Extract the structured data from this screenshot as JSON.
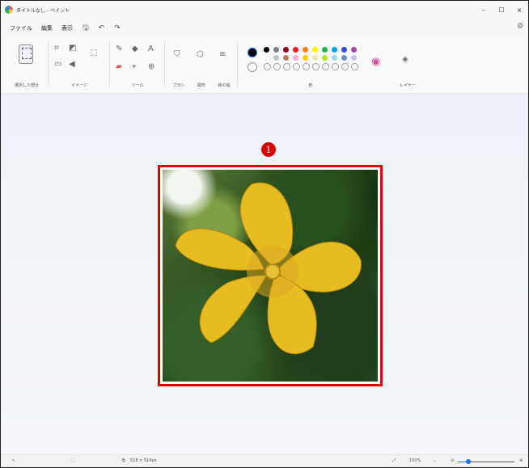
{
  "window": {
    "title": "タイトルなし - ペイント",
    "controls": {
      "minimize": "–",
      "maximize": "☐",
      "close": "×"
    }
  },
  "menu": {
    "file": "ファイル",
    "edit": "編集",
    "view": "表示",
    "save_icon": "save-icon",
    "undo_icon": "undo-icon",
    "redo_icon": "redo-icon",
    "settings_icon": "settings-icon"
  },
  "ribbon": {
    "groups": {
      "selection": "選択した部分",
      "image": "イメージ",
      "tools": "ツール",
      "brushes": "ブラシ",
      "shapes": "図形",
      "size": "線の幅",
      "colors": "色",
      "layers": "レイヤー"
    },
    "tools": {
      "text_glyph": "A",
      "zoom_glyph": "⊕"
    },
    "colors_row1": [
      "#000000",
      "#7f7f7f",
      "#880015",
      "#ed1c24",
      "#ff7f27",
      "#fff200",
      "#22b14c",
      "#00a2e8",
      "#3f48cc",
      "#a349a4"
    ],
    "colors_row2": [
      "#ffffff",
      "#c3c3c3",
      "#b97a57",
      "#ffaec9",
      "#ffc90e",
      "#efe4b0",
      "#b5e61d",
      "#99d9ea",
      "#7092be",
      "#c8bfe7"
    ],
    "primary_color": "#000000",
    "secondary_color": "#ffffff"
  },
  "canvas": {
    "marker_label": "1",
    "image_description": "yellow flower photo"
  },
  "status": {
    "canvas_size": "518 × 514px",
    "zoom_percent": "100%",
    "zoom_fraction": 0.18
  }
}
